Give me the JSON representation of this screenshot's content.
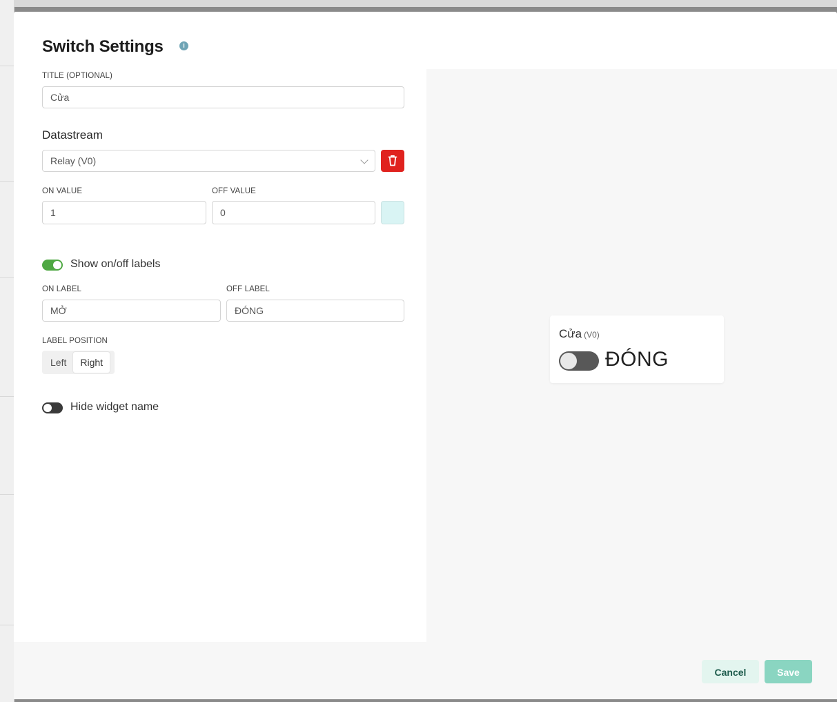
{
  "modal": {
    "title": "Switch Settings",
    "info_icon": "info-icon"
  },
  "form": {
    "title_label": "TITLE (OPTIONAL)",
    "title_value": "Cửa",
    "datastream_heading": "Datastream",
    "datastream_selected": "Relay (V0)",
    "on_value_label": "ON VALUE",
    "on_value": "1",
    "off_value_label": "OFF VALUE",
    "off_value": "0",
    "color_swatch": "#d9f4f4",
    "show_labels_toggle": {
      "label": "Show on/off labels",
      "on": true
    },
    "on_label_label": "ON LABEL",
    "on_label_value": "MỞ",
    "off_label_label": "OFF LABEL",
    "off_label_value": "ĐÓNG",
    "label_position_label": "LABEL POSITION",
    "label_position_options": [
      "Left",
      "Right"
    ],
    "label_position_selected": "Right",
    "hide_name_toggle": {
      "label": "Hide widget name",
      "on": false
    }
  },
  "preview": {
    "widget_title": "Cửa",
    "widget_pin": "(V0)",
    "state_text": "ĐÓNG",
    "switch_on": false
  },
  "footer": {
    "cancel_label": "Cancel",
    "save_label": "Save"
  },
  "colors": {
    "delete": "#e0221e",
    "toggle_on": "#4fa843",
    "save_button": "#8ad5c1",
    "cancel_button": "#e3f5ef"
  }
}
